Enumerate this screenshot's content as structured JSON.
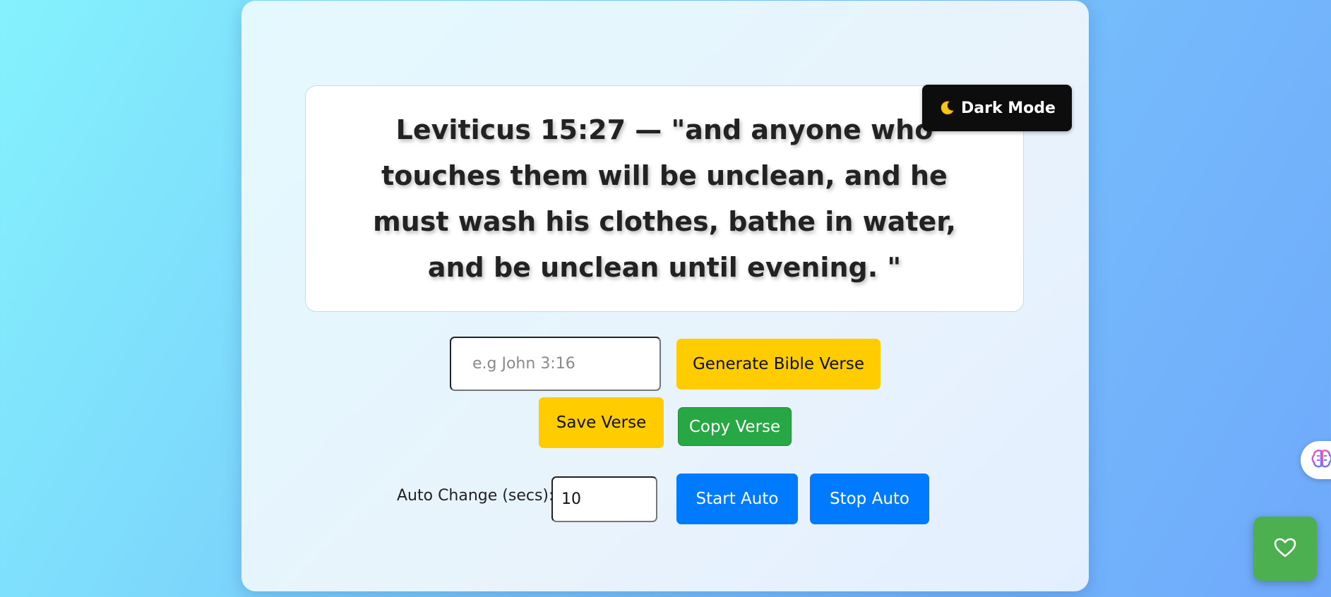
{
  "verse": {
    "text": "Leviticus 15:27 — \"and anyone who touches them will be unclean, and he must wash his clothes, bathe in water, and be unclean until evening. \""
  },
  "theme_toggle": {
    "label": "Dark Mode",
    "icon": "moon-icon"
  },
  "reference_input": {
    "value": "",
    "placeholder": "e.g John 3:16"
  },
  "buttons": {
    "generate": "Generate Bible Verse",
    "save": "Save Verse",
    "copy": "Copy Verse",
    "start_auto": "Start Auto",
    "stop_auto": "Stop Auto"
  },
  "auto_change": {
    "label": "Auto Change (secs):",
    "value": "10"
  },
  "widgets": {
    "side_tab_icon": "brain-icon",
    "favorite_icon": "heart-icon"
  },
  "colors": {
    "primary_yellow": "#ffcc00",
    "copy_green": "#28a745",
    "auto_blue": "#007bff",
    "dark_button": "#0d0d0d",
    "favorite_green": "#4caf50"
  }
}
